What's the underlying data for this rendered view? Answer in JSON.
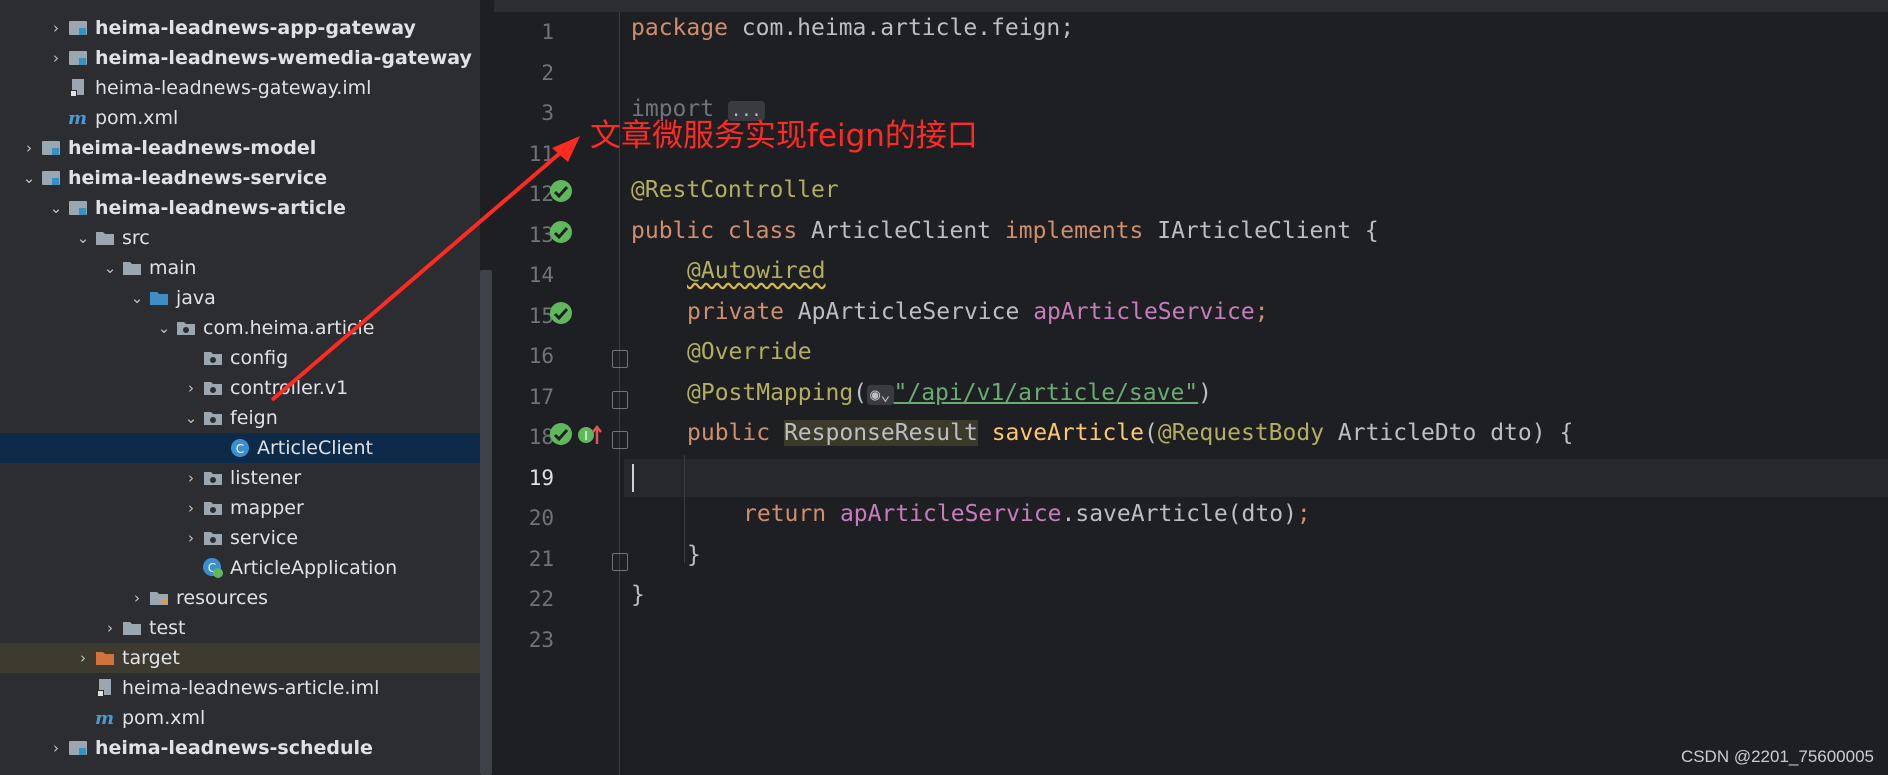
{
  "project_tree": {
    "items": [
      {
        "label": "heima-leadnews-app-gateway",
        "bold": true
      },
      {
        "label": "heima-leadnews-wemedia-gateway",
        "bold": true
      },
      {
        "label": "heima-leadnews-gateway.iml",
        "bold": false
      },
      {
        "label": "pom.xml",
        "bold": false
      },
      {
        "label": "heima-leadnews-model",
        "bold": true
      },
      {
        "label": "heima-leadnews-service",
        "bold": true
      },
      {
        "label": "heima-leadnews-article",
        "bold": true
      },
      {
        "label": "src",
        "bold": false
      },
      {
        "label": "main",
        "bold": false
      },
      {
        "label": "java",
        "bold": false
      },
      {
        "label": "com.heima.article",
        "bold": false
      },
      {
        "label": "config",
        "bold": false
      },
      {
        "label": "controller.v1",
        "bold": false
      },
      {
        "label": "feign",
        "bold": false
      },
      {
        "label": "ArticleClient",
        "bold": false
      },
      {
        "label": "listener",
        "bold": false
      },
      {
        "label": "mapper",
        "bold": false
      },
      {
        "label": "service",
        "bold": false
      },
      {
        "label": "ArticleApplication",
        "bold": false
      },
      {
        "label": "resources",
        "bold": false
      },
      {
        "label": "test",
        "bold": false
      },
      {
        "label": "target",
        "bold": false
      },
      {
        "label": "heima-leadnews-article.iml",
        "bold": false
      },
      {
        "label": "pom.xml",
        "bold": false
      },
      {
        "label": "heima-leadnews-schedule",
        "bold": true
      }
    ]
  },
  "editor": {
    "line_numbers": [
      "1",
      "2",
      "3",
      "11",
      "12",
      "13",
      "14",
      "15",
      "16",
      "17",
      "18",
      "19",
      "20",
      "21",
      "22",
      "23"
    ],
    "lines": {
      "l1_kw": "package",
      "l1_rest": " com.heima.article.feign;",
      "l3_kw": "import",
      "l3_fold": "...",
      "l12": "@RestController",
      "l13_kw1": "public class",
      "l13_name": " ArticleClient ",
      "l13_kw2": "implements",
      "l13_rest": " IArticleClient {",
      "l14": "@Autowired",
      "l15_kw": "private",
      "l15_type": " ApArticleService ",
      "l15_field": "apArticleService",
      "l15_end": ";",
      "l16": "@Override",
      "l17_ann": "@PostMapping",
      "l17_open": "(",
      "l17_str": "\"/api/v1/article/save\"",
      "l17_close": ")",
      "l18_kw": "public",
      "l18_type": "ResponseResult",
      "l18_method": "saveArticle",
      "l18_paren": "(",
      "l18_ann": "@RequestBody",
      "l18_rest": " ArticleDto dto) {",
      "l20_kw": "return",
      "l20_field": "apArticleService",
      "l20_call": ".saveArticle(dto)",
      "l20_end": ";",
      "l21": "}",
      "l22": "}"
    }
  },
  "annotation": {
    "callout_text": "文章微服务实现feign的接口",
    "color": "#ff2a22"
  },
  "watermark": "CSDN @2201_75600005"
}
